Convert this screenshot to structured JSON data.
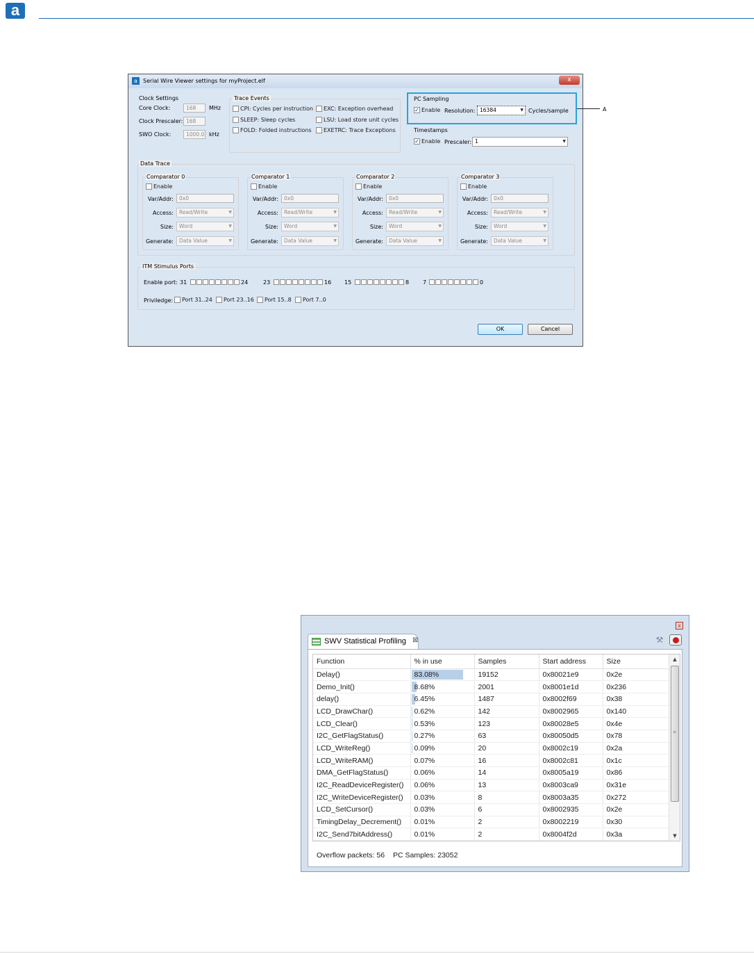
{
  "page": {
    "logo_letter": "a"
  },
  "dialog": {
    "title": "Serial Wire Viewer settings for myProject.elf",
    "close_glyph": "x",
    "clock": {
      "title": "Clock Settings",
      "core_clock_label": "Core Clock:",
      "core_clock_value": "168",
      "core_clock_unit": "MHz",
      "prescaler_label": "Clock Prescaler:",
      "prescaler_value": "168",
      "swo_label": "SWO Clock:",
      "swo_value": "1000.0",
      "swo_unit": "kHz"
    },
    "trace_events": {
      "title": "Trace Events",
      "cpi": "CPI: Cycles per instruction",
      "exc": "EXC: Exception overhead",
      "sleep": "SLEEP: Sleep cycles",
      "lsu": "LSU: Load store unit cycles",
      "fold": "FOLD: Folded instructions",
      "exetrc": "EXETRC: Trace Exceptions"
    },
    "pc_sampling": {
      "title": "PC Sampling",
      "enable_label": "Enable",
      "enabled": true,
      "resolution_label": "Resolution:",
      "resolution_value": "16384",
      "unit": "Cycles/sample",
      "callout": "A"
    },
    "timestamps": {
      "title": "Timestamps",
      "enable_label": "Enable",
      "enabled": true,
      "prescaler_label": "Prescaler:",
      "prescaler_value": "1"
    },
    "data_trace": {
      "title": "Data Trace",
      "comparators": [
        {
          "title": "Comparator 0",
          "enable": "Enable",
          "var_label": "Var/Addr:",
          "var_value": "0x0",
          "access_label": "Access:",
          "access_value": "Read/Write",
          "size_label": "Size:",
          "size_value": "Word",
          "generate_label": "Generate:",
          "generate_value": "Data Value"
        },
        {
          "title": "Comparator 1",
          "enable": "Enable",
          "var_label": "Var/Addr:",
          "var_value": "0x0",
          "access_label": "Access:",
          "access_value": "Read/Write",
          "size_label": "Size:",
          "size_value": "Word",
          "generate_label": "Generate:",
          "generate_value": "Data Value"
        },
        {
          "title": "Comparator 2",
          "enable": "Enable",
          "var_label": "Var/Addr:",
          "var_value": "0x0",
          "access_label": "Access:",
          "access_value": "Read/Write",
          "size_label": "Size:",
          "size_value": "Word",
          "generate_label": "Generate:",
          "generate_value": "Data Value"
        },
        {
          "title": "Comparator 3",
          "enable": "Enable",
          "var_label": "Var/Addr:",
          "var_value": "0x0",
          "access_label": "Access:",
          "access_value": "Read/Write",
          "size_label": "Size:",
          "size_value": "Word",
          "generate_label": "Generate:",
          "generate_value": "Data Value"
        }
      ]
    },
    "itm": {
      "title": "ITM Stimulus Ports",
      "enable_port_label": "Enable port:",
      "groups": [
        {
          "start": "31",
          "end": "24"
        },
        {
          "start": "23",
          "end": "16"
        },
        {
          "start": "15",
          "end": "8"
        },
        {
          "start": "7",
          "end": "0"
        }
      ],
      "privilege_label": "Priviledge:",
      "privilege_ports": [
        "Port 31..24",
        "Port 23..16",
        "Port 15..8",
        "Port 7..0"
      ]
    },
    "ok_label": "OK",
    "cancel_label": "Cancel"
  },
  "profiling": {
    "tab_label": "SWV Statistical Profiling",
    "tab_close": "⊠",
    "close_glyph": "x",
    "pin_glyph": "⚒",
    "columns": [
      "Function",
      "% in use",
      "Samples",
      "Start address",
      "Size"
    ],
    "rows": [
      {
        "function": "Delay()",
        "pct": "83.08%",
        "pct_value": 83.08,
        "samples": "19152",
        "start": "0x80021e9",
        "size": "0x2e"
      },
      {
        "function": "Demo_Init()",
        "pct": "8.68%",
        "pct_value": 8.68,
        "samples": "2001",
        "start": "0x8001e1d",
        "size": "0x236"
      },
      {
        "function": "delay()",
        "pct": "6.45%",
        "pct_value": 6.45,
        "samples": "1487",
        "start": "0x8002f69",
        "size": "0x38"
      },
      {
        "function": "LCD_DrawChar()",
        "pct": "0.62%",
        "pct_value": 0.62,
        "samples": "142",
        "start": "0x8002965",
        "size": "0x140"
      },
      {
        "function": "LCD_Clear()",
        "pct": "0.53%",
        "pct_value": 0.53,
        "samples": "123",
        "start": "0x80028e5",
        "size": "0x4e"
      },
      {
        "function": "I2C_GetFlagStatus()",
        "pct": "0.27%",
        "pct_value": 0.27,
        "samples": "63",
        "start": "0x80050d5",
        "size": "0x78"
      },
      {
        "function": "LCD_WriteReg()",
        "pct": "0.09%",
        "pct_value": 0.09,
        "samples": "20",
        "start": "0x8002c19",
        "size": "0x2a"
      },
      {
        "function": "LCD_WriteRAM()",
        "pct": "0.07%",
        "pct_value": 0.07,
        "samples": "16",
        "start": "0x8002c81",
        "size": "0x1c"
      },
      {
        "function": "DMA_GetFlagStatus()",
        "pct": "0.06%",
        "pct_value": 0.06,
        "samples": "14",
        "start": "0x8005a19",
        "size": "0x86"
      },
      {
        "function": "I2C_ReadDeviceRegister()",
        "pct": "0.06%",
        "pct_value": 0.06,
        "samples": "13",
        "start": "0x8003ca9",
        "size": "0x31e"
      },
      {
        "function": "I2C_WriteDeviceRegister()",
        "pct": "0.03%",
        "pct_value": 0.03,
        "samples": "8",
        "start": "0x8003a35",
        "size": "0x272"
      },
      {
        "function": "LCD_SetCursor()",
        "pct": "0.03%",
        "pct_value": 0.03,
        "samples": "6",
        "start": "0x8002935",
        "size": "0x2e"
      },
      {
        "function": "TimingDelay_Decrement()",
        "pct": "0.01%",
        "pct_value": 0.01,
        "samples": "2",
        "start": "0x8002219",
        "size": "0x30"
      },
      {
        "function": "I2C_Send7bitAddress()",
        "pct": "0.01%",
        "pct_value": 0.01,
        "samples": "2",
        "start": "0x8004f2d",
        "size": "0x3a"
      }
    ],
    "overflow": "Overflow packets: 56",
    "pc_samples": "PC Samples: 23052"
  }
}
